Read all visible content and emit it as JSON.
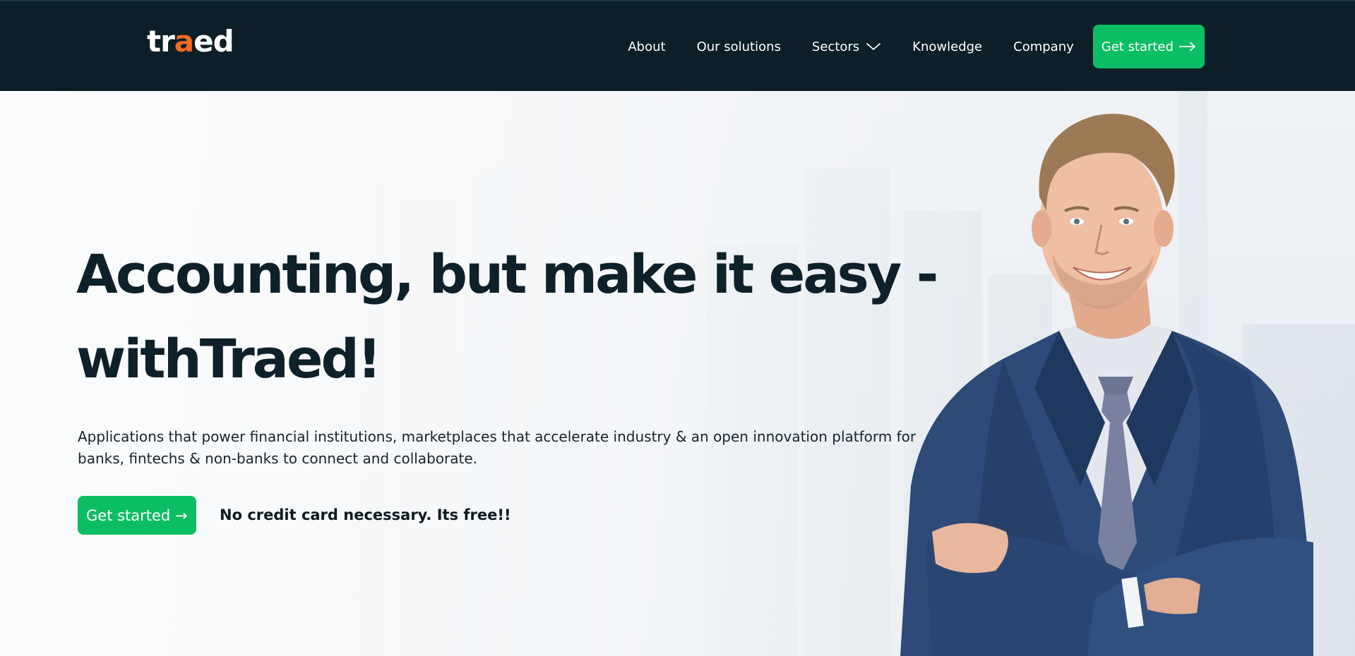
{
  "brand": {
    "logo_part1": "tr",
    "logo_accent": "a",
    "logo_part2": "ed",
    "accent_color": "#0cbe63",
    "logo_accent_color": "#f26a21",
    "navbar_color": "#0c1f28"
  },
  "nav": {
    "items": [
      {
        "label": "About"
      },
      {
        "label": "Our solutions"
      },
      {
        "label": "Sectors",
        "icon": "chevron-down-icon"
      },
      {
        "label": "Knowledge"
      },
      {
        "label": "Company"
      }
    ],
    "cta_label": "Get started",
    "cta_icon": "arrow-right-icon"
  },
  "hero": {
    "title_line1": "Accounting, but make it easy -",
    "title_line2": "withTraed!",
    "description": "Applications that power financial institutions, marketplaces that accelerate industry & an open innovation platform for banks, fintechs & non-banks to connect and collaborate.",
    "cta_label": "Get started →",
    "note": "No credit card necessary. Its free!!",
    "image": "smiling businessman in navy suit with arms crossed, blurred city office background"
  }
}
